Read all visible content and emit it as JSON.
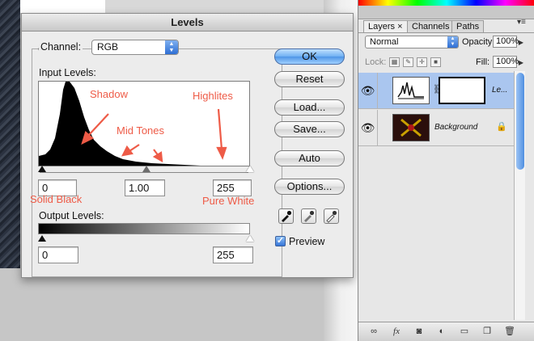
{
  "dialog": {
    "title": "Levels",
    "channel_label": "Channel:",
    "channel_value": "RGB",
    "input_levels_label": "Input Levels:",
    "input_black": "0",
    "input_gamma": "1.00",
    "input_white": "255",
    "output_levels_label": "Output Levels:",
    "output_black": "0",
    "output_white": "255",
    "buttons": {
      "ok": "OK",
      "reset": "Reset",
      "load": "Load...",
      "save": "Save...",
      "auto": "Auto",
      "options": "Options..."
    },
    "preview_label": "Preview",
    "preview_checked": true,
    "annotations": {
      "shadow": "Shadow",
      "highlites": "Highlites",
      "mid_tones": "Mid Tones",
      "solid_black": "Solid Black",
      "pure_white": "Pure White"
    },
    "annotation_color": "#ee5b47"
  },
  "layers_panel": {
    "tabs": [
      "Layers",
      "Channels",
      "Paths"
    ],
    "tab_close_glyph": "×",
    "active_tab": "Layers",
    "blend_mode": "Normal",
    "opacity_label": "Opacity:",
    "opacity_value": "100%",
    "lock_label": "Lock:",
    "fill_label": "Fill:",
    "fill_value": "100%",
    "layers": [
      {
        "name": "Le...",
        "selected": true
      },
      {
        "name": "Background",
        "selected": false
      }
    ],
    "bottom_icons": [
      "link-icon",
      "fx-icon",
      "mask-icon",
      "adjustment-icon",
      "folder-icon",
      "new-layer-icon",
      "trash-icon"
    ],
    "selection_color": "#aac6ef"
  }
}
